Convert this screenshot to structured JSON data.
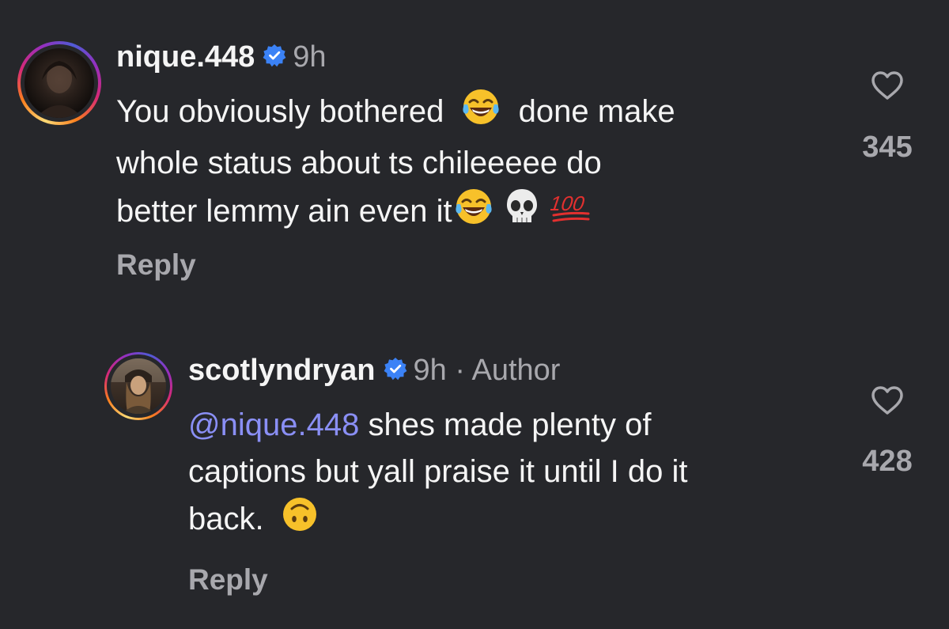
{
  "comments": [
    {
      "username": "nique.448",
      "time": "9h",
      "text_lines": [
        "You obviously bothered",
        "done make",
        "whole status about ts chileeeee do",
        "better lemmy ain even it"
      ],
      "reply_label": "Reply",
      "likes": "345"
    },
    {
      "username": "scotlyndryan",
      "time": "9h · Author",
      "mention": "@nique.448",
      "text_lines": [
        "shes made plenty of",
        "captions but yall praise it until I do it",
        "back."
      ],
      "reply_label": "Reply",
      "likes": "428"
    }
  ],
  "colors": {
    "background": "#26272b",
    "text": "#f5f5f5",
    "secondary": "#a8a8ad",
    "mention": "#8a8ff5",
    "verified": "#3b82f6"
  }
}
